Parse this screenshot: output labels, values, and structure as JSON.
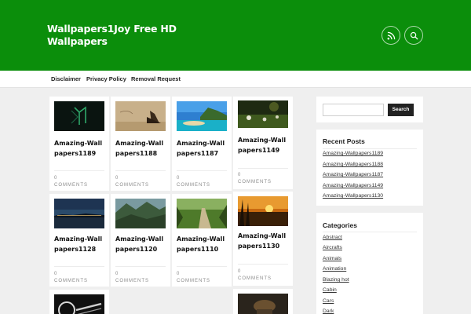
{
  "header": {
    "title": "Wallpapers1Joy Free HD Wallpapers",
    "icons": [
      "rss-icon",
      "search-icon"
    ],
    "bg_color": "#0b8e0b"
  },
  "nav": {
    "items": [
      "Disclaimer",
      "Privacy Policy",
      "Removal Request"
    ]
  },
  "posts": [
    {
      "title": "Amazing-Wallpapers1189",
      "comments": "0",
      "comments_label": "COMMENTS",
      "thumb": "dark-green-logo"
    },
    {
      "title": "Amazing-Wallpapers1188",
      "comments": "0",
      "comments_label": "COMMENTS",
      "thumb": "sepia-ship"
    },
    {
      "title": "Amazing-Wallpapers1187",
      "comments": "0",
      "comments_label": "COMMENTS",
      "thumb": "tropical-coast"
    },
    {
      "title": "Amazing-Wallpapers1149",
      "comments": "0",
      "comments_label": "COMMENTS",
      "thumb": "dandelion-field"
    },
    {
      "title": "Amazing-Wallpapers1128",
      "comments": "0",
      "comments_label": "COMMENTS",
      "thumb": "night-city"
    },
    {
      "title": "Amazing-Wallpapers1120",
      "comments": "0",
      "comments_label": "COMMENTS",
      "thumb": "mountain-valley"
    },
    {
      "title": "Amazing-Wallpapers1110",
      "comments": "0",
      "comments_label": "COMMENTS",
      "thumb": "forest-path"
    },
    {
      "title": "Amazing-Wallpapers1130",
      "comments": "0",
      "comments_label": "COMMENTS",
      "thumb": "sunset-lake"
    },
    {
      "title": "",
      "comments": "",
      "comments_label": "",
      "thumb": "dark-branded"
    },
    {
      "title": "",
      "comments": "",
      "comments_label": "",
      "thumb": "dark-figure"
    }
  ],
  "sidebar": {
    "search_button": "Search",
    "search_placeholder": "",
    "recent_heading": "Recent Posts",
    "recent_posts": [
      "Amazing-Wallpapers1189",
      "Amazing-Wallpapers1188",
      "Amazing-Wallpapers1187",
      "Amazing-Wallpapers1149",
      "Amazing-Wallpapers1130"
    ],
    "categories_heading": "Categories",
    "categories": [
      "Abstract",
      "Aircrafts",
      "Animals",
      "Animation",
      "Blazing hot",
      "Cabin",
      "Cars",
      "Dark"
    ]
  }
}
